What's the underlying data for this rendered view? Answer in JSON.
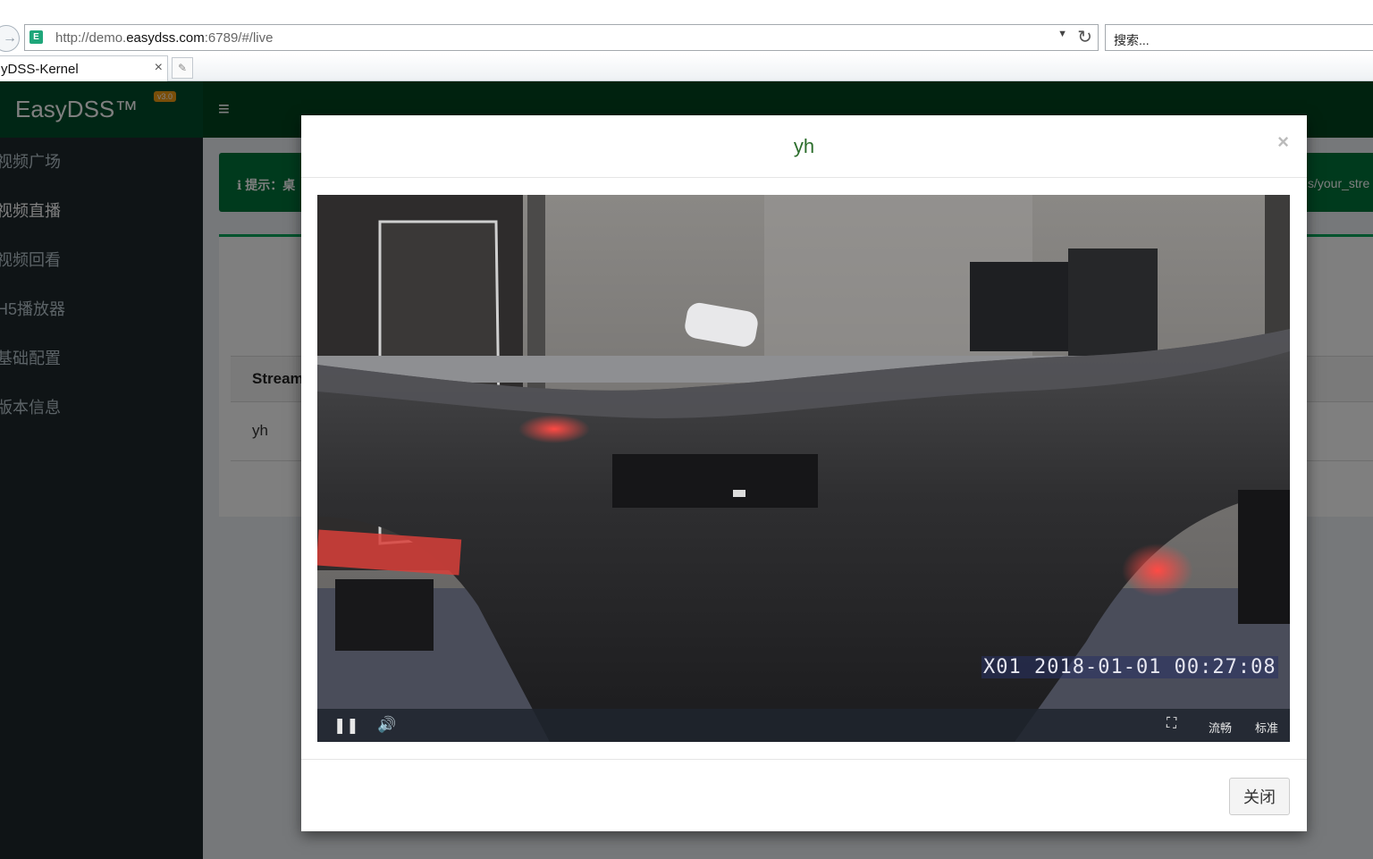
{
  "browser": {
    "url_prefix": "http://demo.",
    "url_host": "easydss.com",
    "url_suffix": ":6789/#/live",
    "search_placeholder": "搜索...",
    "tab_title": "yDSS-Kernel",
    "tab_close": "×"
  },
  "app": {
    "logo": "EasyDSS™",
    "version": "v3.0",
    "hamburger": "≡",
    "menu": [
      {
        "label": "视频广场"
      },
      {
        "label": "视频直播"
      },
      {
        "label": "视频回看"
      },
      {
        "label": "H5播放器"
      },
      {
        "label": "基础配置"
      },
      {
        "label": "版本信息"
      }
    ],
    "alert_text": "ℹ 提示：桌",
    "alert_right": "s/your_stre",
    "table_header": "Stream",
    "table_row": "yh"
  },
  "modal": {
    "title": "yh",
    "close_x": "×",
    "close_button": "关闭",
    "video": {
      "osd_text": "X01 2018-01-01 00:27:08",
      "pause_icon": "❚❚",
      "volume_icon": "🔊",
      "fullscreen_icon": "⛶",
      "quality_fluent": "流畅",
      "quality_standard": "标准"
    }
  }
}
